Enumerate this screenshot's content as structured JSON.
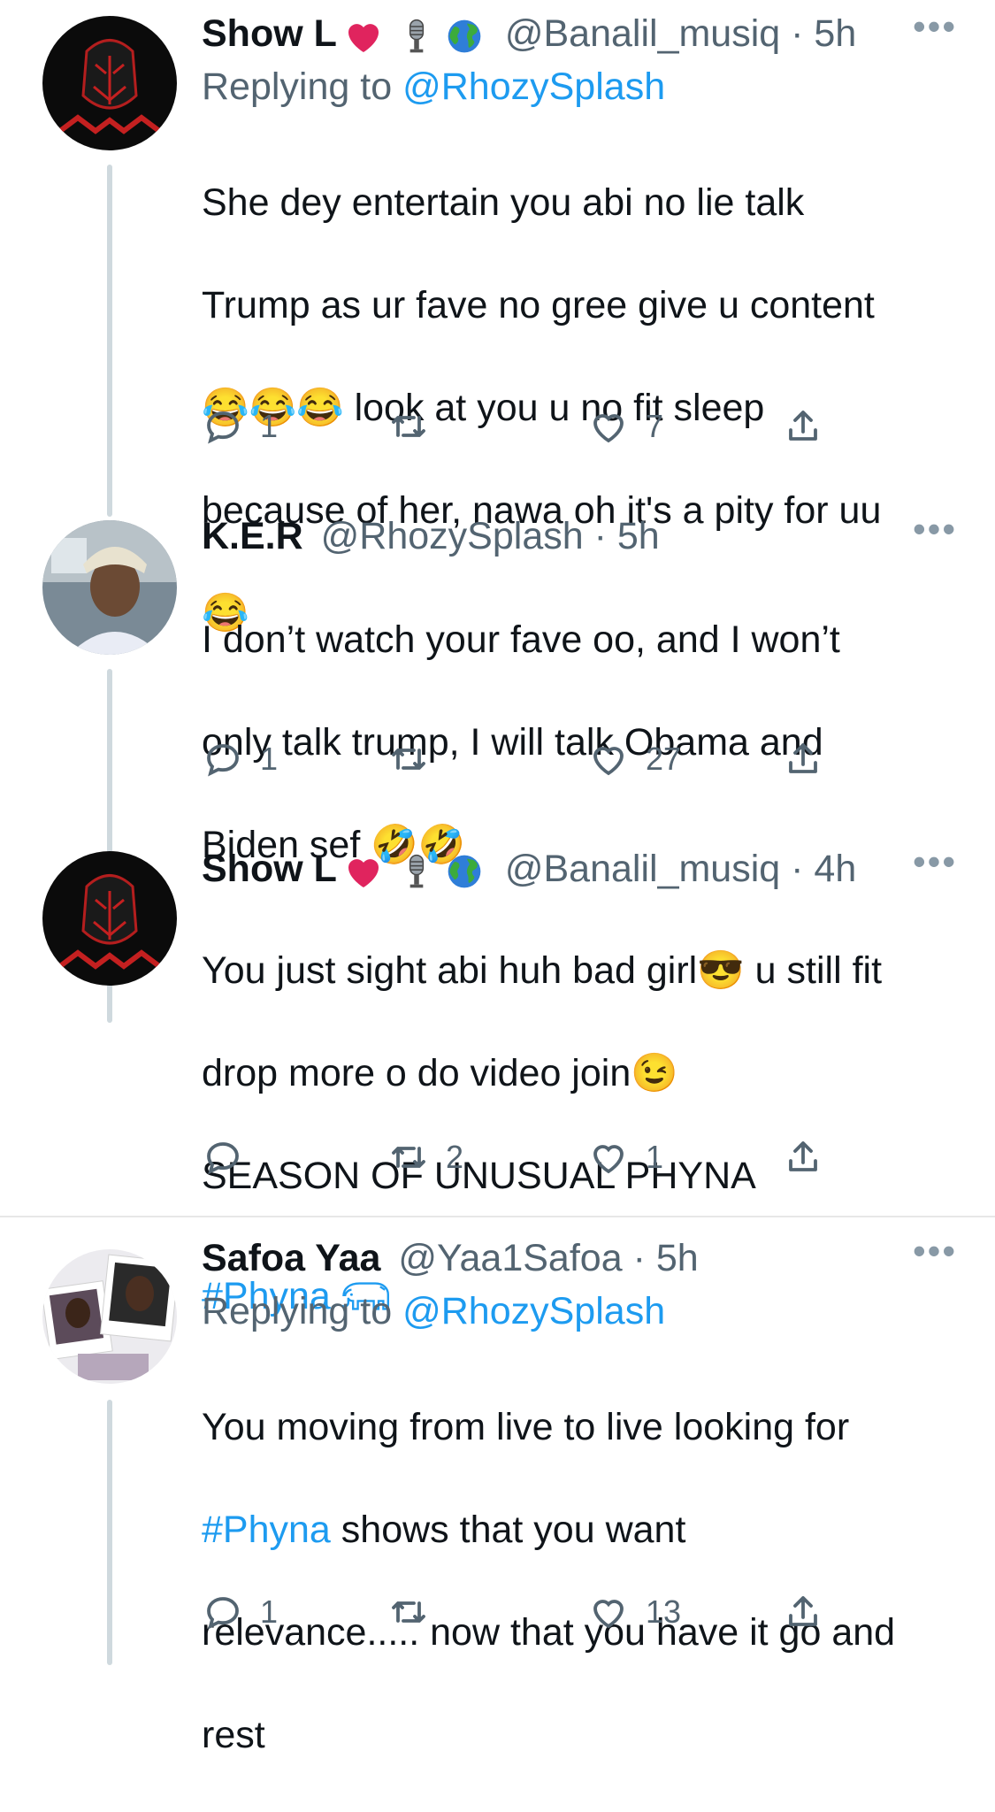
{
  "tweets": [
    {
      "name": "Show L",
      "handle": "@Banalil_musiq",
      "time": "· 5h",
      "replying_label": "Replying to",
      "replying_to": "@RhozySplash",
      "body_lines": [
        "She dey entertain you abi no lie talk",
        "Trump as ur fave no gree give u content",
        "😂😂😂 look at you u no fit sleep",
        "because of her, nawa oh it's a pity for uu",
        "😂"
      ],
      "replies": "1",
      "retweets": "",
      "likes": "7"
    },
    {
      "name": "K.E.R",
      "handle": "@RhozySplash",
      "time": "· 5h",
      "body_lines": [
        "I don’t watch your fave oo, and I won’t",
        "only talk trump, I will talk Obama and",
        "Biden sef 🤣🤣"
      ],
      "replies": "1",
      "retweets": "",
      "likes": "27"
    },
    {
      "name": "Show L",
      "handle": "@Banalil_musiq",
      "time": "· 4h",
      "body_lines": [
        "You just sight abi huh bad girl😎 u still fit",
        "drop more o do video join😉",
        "SEASON OF UNUSUAL PHYNA"
      ],
      "hashtag": "#Phyna",
      "replies": "",
      "retweets": "2",
      "likes": "1"
    },
    {
      "name": "Safoa Yaa",
      "handle": "@Yaa1Safoa",
      "time": "· 5h",
      "replying_label": "Replying to",
      "replying_to": "@RhozySplash",
      "body_line1": "You moving from live to live looking for",
      "body_hashtag": "#Phyna",
      "body_line2_rest": " shows that you want",
      "body_line3": "relevance..... now that you have it go and",
      "body_line4": "rest",
      "replies": "1",
      "retweets": "",
      "likes": "13"
    }
  ],
  "icons": {
    "more": "more-icon",
    "reply": "reply-icon",
    "retweet": "retweet-icon",
    "like": "heart-icon",
    "share": "share-icon",
    "heart_emoji": "red-heart-icon",
    "mic": "microphone-icon",
    "globe": "globe-icon",
    "elephant": "elephant-icon"
  },
  "colors": {
    "link": "#1d9bf0",
    "meta": "#536471",
    "heart": "#e0245e",
    "thread_line": "#cfd9de"
  }
}
